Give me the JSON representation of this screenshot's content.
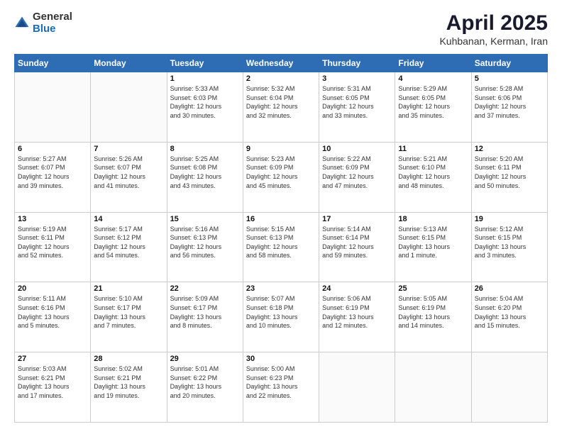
{
  "logo": {
    "general": "General",
    "blue": "Blue"
  },
  "header": {
    "month_year": "April 2025",
    "location": "Kuhbanan, Kerman, Iran"
  },
  "weekdays": [
    "Sunday",
    "Monday",
    "Tuesday",
    "Wednesday",
    "Thursday",
    "Friday",
    "Saturday"
  ],
  "weeks": [
    [
      {
        "day": "",
        "info": ""
      },
      {
        "day": "",
        "info": ""
      },
      {
        "day": "1",
        "info": "Sunrise: 5:33 AM\nSunset: 6:03 PM\nDaylight: 12 hours\nand 30 minutes."
      },
      {
        "day": "2",
        "info": "Sunrise: 5:32 AM\nSunset: 6:04 PM\nDaylight: 12 hours\nand 32 minutes."
      },
      {
        "day": "3",
        "info": "Sunrise: 5:31 AM\nSunset: 6:05 PM\nDaylight: 12 hours\nand 33 minutes."
      },
      {
        "day": "4",
        "info": "Sunrise: 5:29 AM\nSunset: 6:05 PM\nDaylight: 12 hours\nand 35 minutes."
      },
      {
        "day": "5",
        "info": "Sunrise: 5:28 AM\nSunset: 6:06 PM\nDaylight: 12 hours\nand 37 minutes."
      }
    ],
    [
      {
        "day": "6",
        "info": "Sunrise: 5:27 AM\nSunset: 6:07 PM\nDaylight: 12 hours\nand 39 minutes."
      },
      {
        "day": "7",
        "info": "Sunrise: 5:26 AM\nSunset: 6:07 PM\nDaylight: 12 hours\nand 41 minutes."
      },
      {
        "day": "8",
        "info": "Sunrise: 5:25 AM\nSunset: 6:08 PM\nDaylight: 12 hours\nand 43 minutes."
      },
      {
        "day": "9",
        "info": "Sunrise: 5:23 AM\nSunset: 6:09 PM\nDaylight: 12 hours\nand 45 minutes."
      },
      {
        "day": "10",
        "info": "Sunrise: 5:22 AM\nSunset: 6:09 PM\nDaylight: 12 hours\nand 47 minutes."
      },
      {
        "day": "11",
        "info": "Sunrise: 5:21 AM\nSunset: 6:10 PM\nDaylight: 12 hours\nand 48 minutes."
      },
      {
        "day": "12",
        "info": "Sunrise: 5:20 AM\nSunset: 6:11 PM\nDaylight: 12 hours\nand 50 minutes."
      }
    ],
    [
      {
        "day": "13",
        "info": "Sunrise: 5:19 AM\nSunset: 6:11 PM\nDaylight: 12 hours\nand 52 minutes."
      },
      {
        "day": "14",
        "info": "Sunrise: 5:17 AM\nSunset: 6:12 PM\nDaylight: 12 hours\nand 54 minutes."
      },
      {
        "day": "15",
        "info": "Sunrise: 5:16 AM\nSunset: 6:13 PM\nDaylight: 12 hours\nand 56 minutes."
      },
      {
        "day": "16",
        "info": "Sunrise: 5:15 AM\nSunset: 6:13 PM\nDaylight: 12 hours\nand 58 minutes."
      },
      {
        "day": "17",
        "info": "Sunrise: 5:14 AM\nSunset: 6:14 PM\nDaylight: 12 hours\nand 59 minutes."
      },
      {
        "day": "18",
        "info": "Sunrise: 5:13 AM\nSunset: 6:15 PM\nDaylight: 13 hours\nand 1 minute."
      },
      {
        "day": "19",
        "info": "Sunrise: 5:12 AM\nSunset: 6:15 PM\nDaylight: 13 hours\nand 3 minutes."
      }
    ],
    [
      {
        "day": "20",
        "info": "Sunrise: 5:11 AM\nSunset: 6:16 PM\nDaylight: 13 hours\nand 5 minutes."
      },
      {
        "day": "21",
        "info": "Sunrise: 5:10 AM\nSunset: 6:17 PM\nDaylight: 13 hours\nand 7 minutes."
      },
      {
        "day": "22",
        "info": "Sunrise: 5:09 AM\nSunset: 6:17 PM\nDaylight: 13 hours\nand 8 minutes."
      },
      {
        "day": "23",
        "info": "Sunrise: 5:07 AM\nSunset: 6:18 PM\nDaylight: 13 hours\nand 10 minutes."
      },
      {
        "day": "24",
        "info": "Sunrise: 5:06 AM\nSunset: 6:19 PM\nDaylight: 13 hours\nand 12 minutes."
      },
      {
        "day": "25",
        "info": "Sunrise: 5:05 AM\nSunset: 6:19 PM\nDaylight: 13 hours\nand 14 minutes."
      },
      {
        "day": "26",
        "info": "Sunrise: 5:04 AM\nSunset: 6:20 PM\nDaylight: 13 hours\nand 15 minutes."
      }
    ],
    [
      {
        "day": "27",
        "info": "Sunrise: 5:03 AM\nSunset: 6:21 PM\nDaylight: 13 hours\nand 17 minutes."
      },
      {
        "day": "28",
        "info": "Sunrise: 5:02 AM\nSunset: 6:21 PM\nDaylight: 13 hours\nand 19 minutes."
      },
      {
        "day": "29",
        "info": "Sunrise: 5:01 AM\nSunset: 6:22 PM\nDaylight: 13 hours\nand 20 minutes."
      },
      {
        "day": "30",
        "info": "Sunrise: 5:00 AM\nSunset: 6:23 PM\nDaylight: 13 hours\nand 22 minutes."
      },
      {
        "day": "",
        "info": ""
      },
      {
        "day": "",
        "info": ""
      },
      {
        "day": "",
        "info": ""
      }
    ]
  ]
}
